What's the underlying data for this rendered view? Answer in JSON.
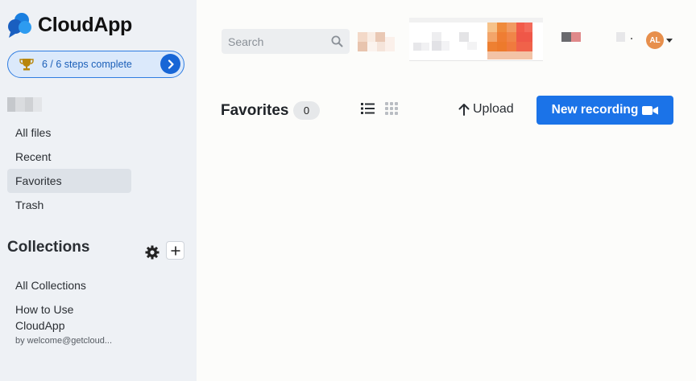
{
  "app": {
    "name": "CloudApp"
  },
  "onboarding": {
    "steps_label": "6 / 6 steps complete"
  },
  "sidebar": {
    "items": [
      {
        "label": "All files",
        "active": false
      },
      {
        "label": "Recent",
        "active": false
      },
      {
        "label": "Favorites",
        "active": true
      },
      {
        "label": "Trash",
        "active": false
      }
    ],
    "collections_title": "Collections",
    "collections": [
      {
        "label": "All Collections"
      },
      {
        "label": "How to Use CloudApp",
        "sub": "by welcome@getcloud..."
      }
    ]
  },
  "header": {
    "search_placeholder": "Search",
    "avatar_initials": "AL"
  },
  "main": {
    "title": "Favorites",
    "count": "0",
    "upload_label": "Upload",
    "new_recording_label": "New recording"
  },
  "colors": {
    "primary": "#1b73e8",
    "sidebar_bg": "#eef1f5",
    "avatar": "#e78f4c"
  },
  "icons": [
    "cloudapp-logo-icon",
    "trophy-icon",
    "chevron-right-icon",
    "gear-icon",
    "plus-icon",
    "search-icon",
    "list-view-icon",
    "grid-view-icon",
    "upload-arrow-icon",
    "video-camera-icon"
  ]
}
